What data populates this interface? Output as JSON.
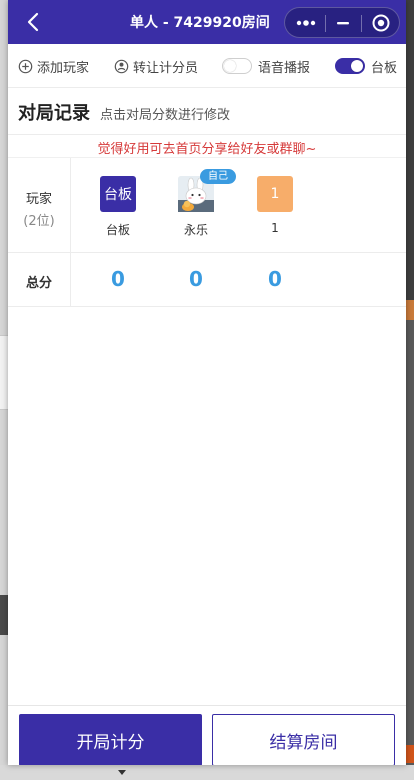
{
  "nav": {
    "title": "单人 - 7429920房间"
  },
  "toolbar": {
    "add_player": "添加玩家",
    "transfer_scorer": "转让计分员",
    "voice_broadcast": "语音播报",
    "voice_on": false,
    "board": "台板",
    "board_on": true
  },
  "section": {
    "title": "对局记录",
    "subtitle": "点击对局分数进行修改"
  },
  "share_text": "觉得好用可去首页分享给好友或群聊~",
  "table": {
    "players_label": "玩家",
    "players_count": "(2位)",
    "total_label": "总分",
    "players": [
      {
        "avatar_text": "台板",
        "name": "台板",
        "color": "#3a2ea6",
        "score": "0"
      },
      {
        "avatar_text": "",
        "name": "永乐",
        "badge": "自己",
        "score": "0"
      },
      {
        "avatar_text": "1",
        "name": "1",
        "color": "#f7ad6a",
        "score": "0"
      }
    ]
  },
  "bottom": {
    "start_label": "开局计分",
    "settle_label": "结算房间"
  },
  "colors": {
    "primary": "#3a2ea6",
    "score_blue": "#3a9be0",
    "notice_red": "#d63a3a"
  }
}
